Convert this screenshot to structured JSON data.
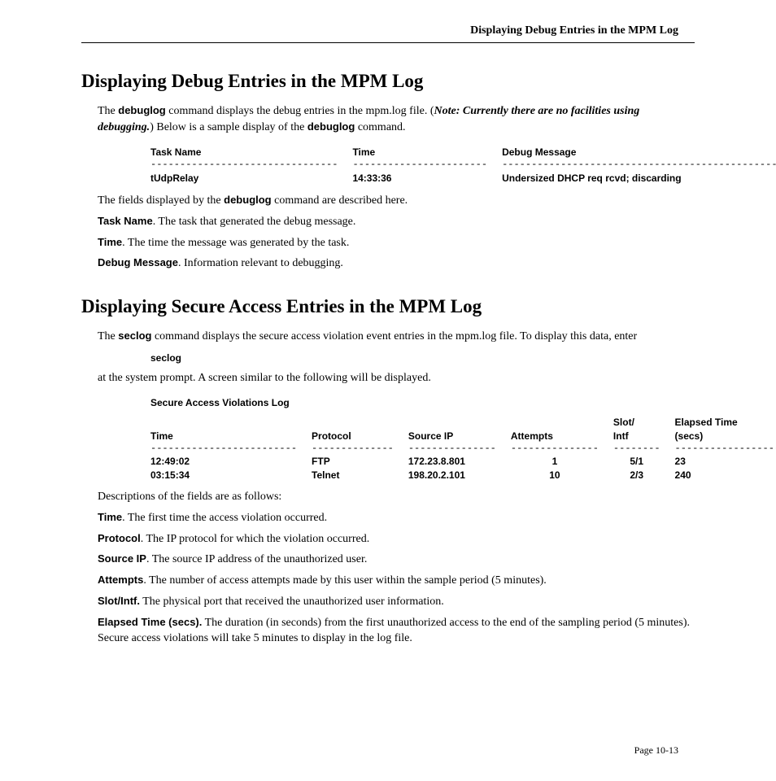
{
  "running_head": "Displaying Debug Entries in the MPM Log",
  "section1": {
    "title": "Displaying Debug Entries in the MPM Log",
    "p1_a": "The ",
    "p1_cmd": "debuglog",
    "p1_b": " command displays the debug entries in the mpm.log file. (",
    "p1_note": "Note: Currently there are no facilities using debugging.",
    "p1_c": ") Below is a sample display of the ",
    "p1_cmd2": "debuglog",
    "p1_d": " command.",
    "table": {
      "h1": "Task Name",
      "h2": "Time",
      "h3": "Debug Message",
      "d1": "--------------------------------",
      "d2": "-----------------------",
      "d3": "---------------------------------------------------------",
      "r1c1": "tUdpRelay",
      "r1c2": "14:33:36",
      "r1c3": "Undersized DHCP req rcvd; discarding"
    },
    "p2_a": "The fields displayed by the ",
    "p2_cmd": "debuglog",
    "p2_b": " command are described here.",
    "f1_label": "Task Name",
    "f1_body": ". The task that generated the debug message.",
    "f2_label": "Time",
    "f2_body": ". The time the message was generated by the task.",
    "f3_label": "Debug Message",
    "f3_body": ". Information relevant to debugging."
  },
  "section2": {
    "title": "Displaying Secure Access Entries in the MPM Log",
    "p1_a": "The ",
    "p1_cmd": "seclog",
    "p1_b": " command displays the secure access violation event entries in the mpm.log file. To display this data, enter",
    "code": "seclog",
    "p2": "at the system prompt. A screen similar to the following will be displayed.",
    "table": {
      "title": "Secure Access Violations Log",
      "h1": "Time",
      "h2": "Protocol",
      "h3": "Source IP",
      "h4": "Attempts",
      "h5_a": "Slot/",
      "h5_b": "Intf",
      "h6_a": "Elapsed Time",
      "h6_b": "(secs)",
      "d1": "-------------------------",
      "d2": "--------------",
      "d3": "---------------",
      "d4": "---------------",
      "d5": "--------",
      "d6": "---------------------",
      "r1": {
        "c1": "12:49:02",
        "c2": "FTP",
        "c3": "172.23.8.801",
        "c4": "1",
        "c5": "5/1",
        "c6": "23"
      },
      "r2": {
        "c1": "03:15:34",
        "c2": "Telnet",
        "c3": "198.20.2.101",
        "c4": "10",
        "c5": "2/3",
        "c6": "240"
      }
    },
    "p3": "Descriptions of the fields are as follows:",
    "f1_label": "Time",
    "f1_body": ". The first time the access violation occurred.",
    "f2_label": "Protocol",
    "f2_body": ". The IP protocol for which the violation occurred.",
    "f3_label": "Source IP",
    "f3_body": ". The source IP address of the unauthorized user.",
    "f4_label": "Attempts",
    "f4_body": ". The number of access attempts made by this user within the sample period (5 minutes).",
    "f5_label": "Slot/Intf.",
    "f5_body": " The physical port that received the unauthorized user information.",
    "f6_label": "Elapsed Time (secs).",
    "f6_body": " The duration (in seconds) from the first unauthorized access to the end of the sampling period (5 minutes). Secure access violations will take 5 minutes to display in the log file."
  },
  "page_num": "Page 10-13"
}
